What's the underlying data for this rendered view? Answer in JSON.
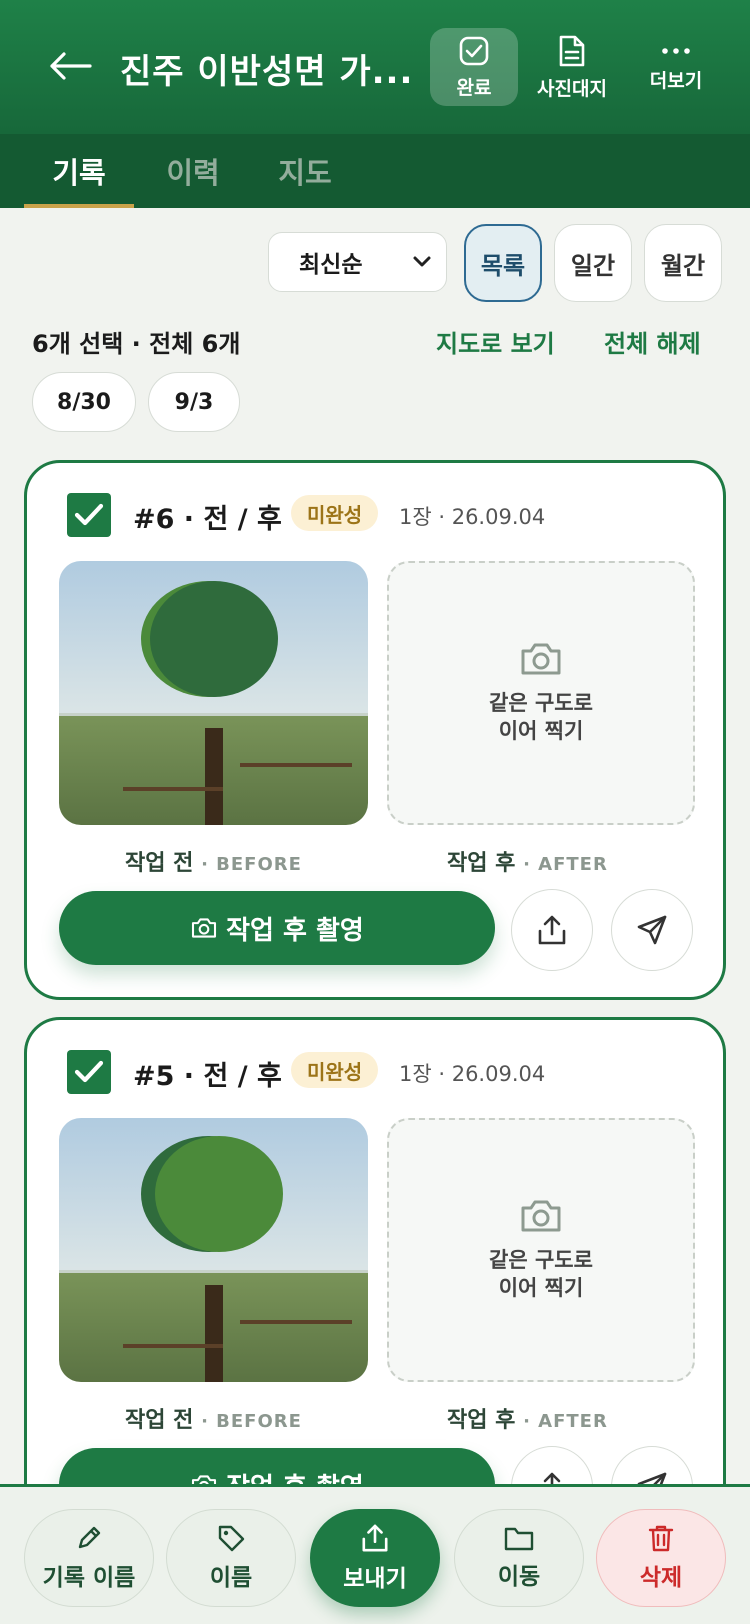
{
  "header": {
    "title": "진주 이반성면 가...",
    "done_label": "완료",
    "photo_sheet_label": "사진대지",
    "more_label": "더보기"
  },
  "tabs": [
    {
      "label": "기록",
      "active": true
    },
    {
      "label": "이력",
      "active": false
    },
    {
      "label": "지도",
      "active": false
    }
  ],
  "controls": {
    "sort_value": "최신순",
    "view_list": "목록",
    "view_daily": "일간",
    "view_monthly": "월간",
    "active_view": "목록"
  },
  "selection": {
    "summary": "6개 선택 · 전체 6개",
    "map_link": "지도로 보기",
    "clear_link": "전체 해제"
  },
  "date_chips": [
    "8/30",
    "9/3"
  ],
  "cards": [
    {
      "checked": true,
      "title": "#6 · 전 / 후",
      "badge": "미완성",
      "meta": "1장 · 26.09.04",
      "after_hint_line1": "같은 구도로",
      "after_hint_line2": "이어 찍기",
      "before_label": "작업 전",
      "before_en": "· BEFORE",
      "after_label": "작업 후",
      "after_en": "· AFTER",
      "shoot_label": "작업 후 촬영",
      "canopy_color": "#2f6b3c",
      "canopy_shadow": "#4b8a3a"
    },
    {
      "checked": true,
      "title": "#5 · 전 / 후",
      "badge": "미완성",
      "meta": "1장 · 26.09.04",
      "after_hint_line1": "같은 구도로",
      "after_hint_line2": "이어 찍기",
      "before_label": "작업 전",
      "before_en": "· BEFORE",
      "after_label": "작업 후",
      "after_en": "· AFTER",
      "shoot_label": "작업 후 촬영",
      "canopy_color": "#4b8a3a",
      "canopy_shadow": "#2f6b3c"
    }
  ],
  "bottom_bar": {
    "rename": "기록 이름",
    "name": "이름",
    "send": "보내기",
    "move": "이동",
    "delete": "삭제"
  },
  "colors": {
    "brand": "#1e7a44",
    "header": "#17683a",
    "tab_bar": "#145a32",
    "tab_underline": "#c9a24a",
    "badge_bg": "#fcf0d4",
    "badge_text": "#9c7418",
    "delete": "#cc2a2a"
  }
}
